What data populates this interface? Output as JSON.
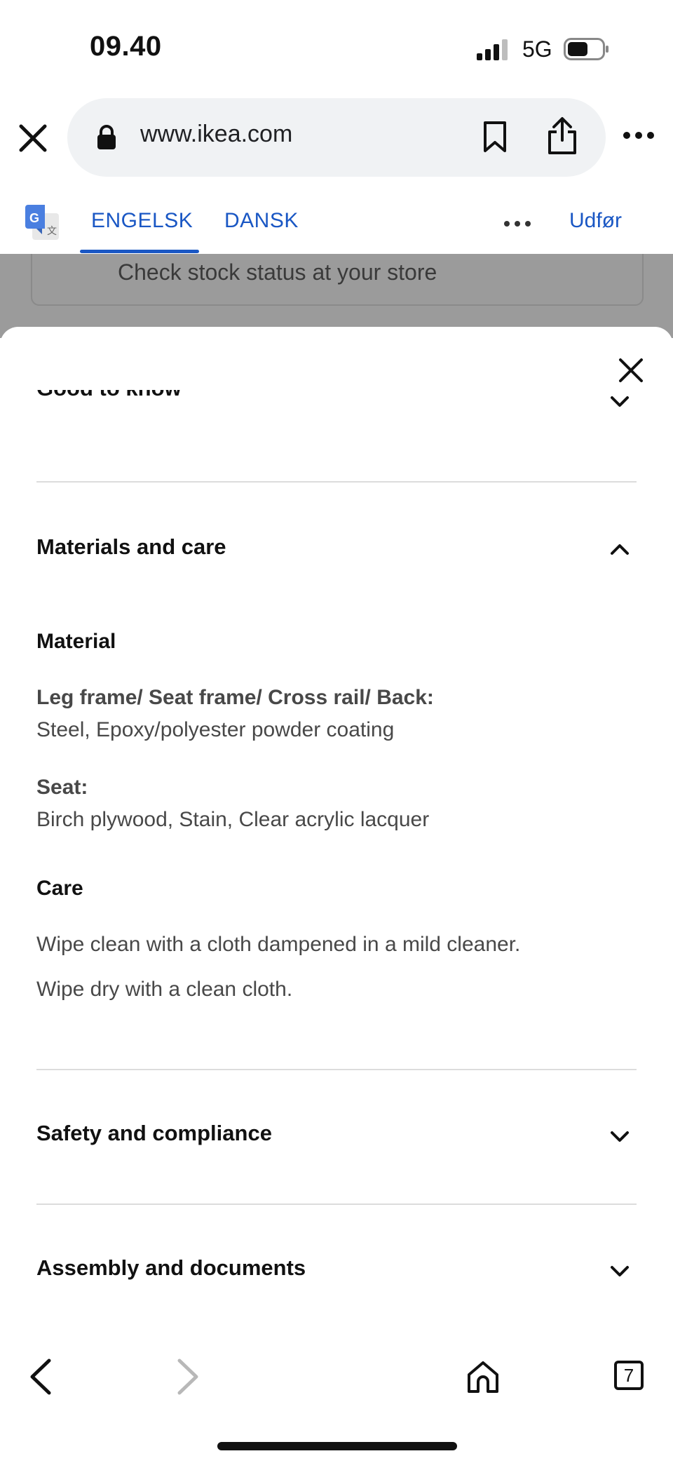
{
  "status_bar": {
    "time": "09.40",
    "network": "5G"
  },
  "browser": {
    "url": "www.ikea.com"
  },
  "translate": {
    "lang_from": "ENGELSK",
    "lang_to": "DANSK",
    "done_label": "Udfør"
  },
  "background": {
    "stock_text": "Check stock status at your store"
  },
  "sheet": {
    "good_to_know": "Good to know",
    "materials_title": "Materials and care",
    "material_heading": "Material",
    "parts": [
      {
        "label": "Leg frame/ Seat frame/ Cross rail/ Back:",
        "value": "Steel, Epoxy/polyester powder coating"
      },
      {
        "label": "Seat:",
        "value": "Birch plywood, Stain, Clear acrylic lacquer"
      }
    ],
    "care_heading": "Care",
    "care_lines": [
      "Wipe clean with a cloth dampened in a mild cleaner.",
      "Wipe dry with a clean cloth."
    ],
    "safety_title": "Safety and compliance",
    "assembly_title": "Assembly and documents"
  },
  "bottom_nav": {
    "tab_count": "7"
  },
  "colors": {
    "accent": "#1a57c4",
    "dim": "#9b9b9b",
    "divider": "#dcdcdc"
  }
}
